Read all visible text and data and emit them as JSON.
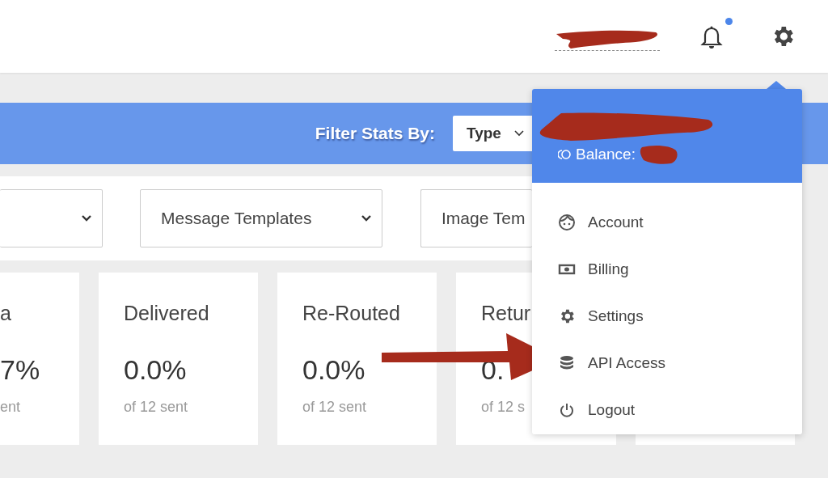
{
  "top_bar": {
    "notifications": {
      "unread": true
    }
  },
  "filter_bar": {
    "label": "Filter Stats By:",
    "select": {
      "value": "Type"
    }
  },
  "dropdowns": [
    {
      "value": "Message Templates"
    },
    {
      "value": "Image Tem"
    }
  ],
  "stat_cards": [
    {
      "title": "a",
      "value": "7%",
      "caption": "ent"
    },
    {
      "title": "Delivered",
      "value": "0.0%",
      "caption": "of 12 sent"
    },
    {
      "title": "Re-Routed",
      "value": "0.0%",
      "caption": "of 12 sent"
    },
    {
      "title": "Retur",
      "value": "0.",
      "caption": "of 12 s"
    }
  ],
  "account_menu": {
    "balance_label": "Balance:",
    "items": [
      {
        "kind": "account",
        "label": "Account"
      },
      {
        "kind": "billing",
        "label": "Billing"
      },
      {
        "kind": "settings",
        "label": "Settings"
      },
      {
        "kind": "api",
        "label": "API Access"
      },
      {
        "kind": "logout",
        "label": "Logout"
      }
    ]
  }
}
